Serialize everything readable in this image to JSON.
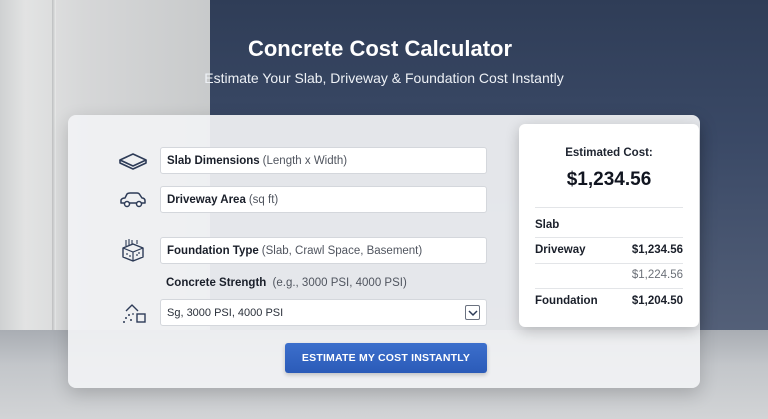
{
  "header": {
    "title": "Concrete Cost Calculator",
    "subtitle": "Estimate Your Slab, Driveway & Foundation Cost Instantly"
  },
  "form": {
    "slab": {
      "label": "Slab Dimensions",
      "hint": "(Length x Width)",
      "icon": "slab-icon"
    },
    "driveway": {
      "label": "Driveway Area",
      "hint": "(sq ft)",
      "icon": "car-icon"
    },
    "foundation": {
      "label": "Foundation Type",
      "hint": "(Slab, Crawl Space, Basement)",
      "icon": "foundation-icon"
    },
    "strength": {
      "label": "Concrete Strength",
      "hint": "(e.g., 3000 PSI, 4000 PSI)",
      "selected": "Sg, 3000 PSI, 4000 PSI",
      "icon": "mixer-icon"
    },
    "submit_label": "ESTIMATE MY COST INSTANTLY"
  },
  "summary": {
    "label": "Estimated Cost:",
    "total": "$1,234.56",
    "rows": [
      {
        "name": "Slab",
        "value": ""
      },
      {
        "name": "Driveway",
        "value": "$1,234.56"
      },
      {
        "name": "",
        "value": "$1,224.56"
      },
      {
        "name": "Foundation",
        "value": "$1,204.50"
      }
    ]
  },
  "colors": {
    "accent": "#2f62c2",
    "wall": "#3a4966"
  }
}
